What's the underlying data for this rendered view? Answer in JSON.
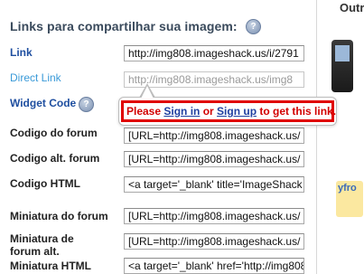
{
  "section": {
    "title": "Links para compartilhar sua imagem:",
    "help_icon": "question-mark-icon"
  },
  "rows": [
    {
      "label": "Link",
      "value": "http://img808.imageshack.us/i/2791",
      "style": "blue",
      "disabled": false
    },
    {
      "label": "Direct Link",
      "value": "http://img808.imageshack.us/img8",
      "style": "light",
      "disabled": true
    },
    {
      "label": "Widget Code",
      "value": "",
      "style": "blue",
      "disabled": false
    },
    {
      "label": "Codigo do forum",
      "value": "[URL=http://img808.imageshack.us/",
      "style": "dark",
      "disabled": false
    },
    {
      "label": "Codigo alt. forum",
      "value": "[URL=http://img808.imageshack.us/",
      "style": "dark",
      "disabled": false
    },
    {
      "label": "Codigo HTML",
      "value": "<a target='_blank' title='ImageShack",
      "style": "dark",
      "disabled": false
    },
    {
      "label": "Miniatura do forum",
      "value": "[URL=http://img808.imageshack.us/",
      "style": "dark",
      "disabled": false
    },
    {
      "label": "Miniatura de forum alt.",
      "value": "[URL=http://img808.imageshack.us/",
      "style": "dark",
      "disabled": false
    },
    {
      "label": "Miniatura HTML",
      "value": "<a target='_blank' href='http://img808",
      "style": "dark",
      "disabled": false
    }
  ],
  "popup": {
    "prefix": "Please ",
    "sign_in": "Sign in",
    "middle": " or ",
    "sign_up": "Sign up",
    "suffix": " to get this link."
  },
  "side": {
    "title": "Outr",
    "logo_text": "yfro"
  },
  "colors": {
    "heading": "#3a4a5c",
    "link_label": "#1f4fa0",
    "disabled_label": "#3a9ad8",
    "popup_border": "#e00000",
    "popup_text": "#d20000"
  }
}
